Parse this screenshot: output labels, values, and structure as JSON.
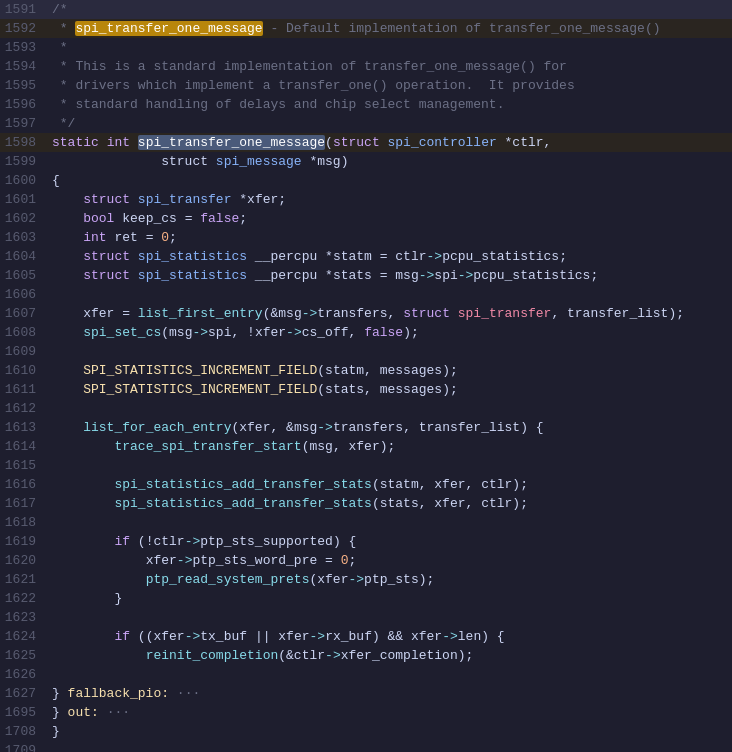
{
  "editor": {
    "lines": [
      {
        "num": "1591",
        "tokens": [
          {
            "t": "/*",
            "c": "c-comment"
          }
        ]
      },
      {
        "num": "1592",
        "tokens": [
          {
            "t": " * ",
            "c": "c-comment"
          },
          {
            "t": "spi_transfer_one_message",
            "c": "c-highlight-yellow"
          },
          {
            "t": " - Default implementation of transfer_one_message()",
            "c": "c-comment"
          }
        ],
        "highlight": true
      },
      {
        "num": "1593",
        "tokens": [
          {
            "t": " *",
            "c": "c-comment"
          }
        ]
      },
      {
        "num": "1594",
        "tokens": [
          {
            "t": " * This is a standard implementation of transfer_one_message() for",
            "c": "c-comment"
          }
        ]
      },
      {
        "num": "1595",
        "tokens": [
          {
            "t": " * drivers which implement a transfer_one() operation.  It provides",
            "c": "c-comment"
          }
        ]
      },
      {
        "num": "1596",
        "tokens": [
          {
            "t": " * standard handling of delays and chip select management.",
            "c": "c-comment"
          }
        ]
      },
      {
        "num": "1597",
        "tokens": [
          {
            "t": " */",
            "c": "c-comment"
          }
        ]
      },
      {
        "num": "1598",
        "tokens": [
          {
            "t": "static",
            "c": "c-keyword"
          },
          {
            "t": " ",
            "c": "c-white"
          },
          {
            "t": "int",
            "c": "c-keyword"
          },
          {
            "t": " ",
            "c": "c-white"
          },
          {
            "t": "spi_transfer_one_message",
            "c": "c-highlight-blue"
          },
          {
            "t": "(",
            "c": "c-white"
          },
          {
            "t": "struct",
            "c": "c-keyword"
          },
          {
            "t": " ",
            "c": "c-white"
          },
          {
            "t": "spi_controller",
            "c": "c-type"
          },
          {
            "t": " *",
            "c": "c-white"
          },
          {
            "t": "ctlr",
            "c": "c-var"
          },
          {
            "t": ",",
            "c": "c-white"
          }
        ],
        "highlight": true
      },
      {
        "num": "1599",
        "tokens": [
          {
            "t": "              struct ",
            "c": "c-white"
          },
          {
            "t": "spi_message",
            "c": "c-type"
          },
          {
            "t": " *",
            "c": "c-white"
          },
          {
            "t": "msg",
            "c": "c-var"
          },
          {
            "t": ")",
            "c": "c-white"
          }
        ]
      },
      {
        "num": "1600",
        "tokens": [
          {
            "t": "{",
            "c": "c-white"
          }
        ]
      },
      {
        "num": "1601",
        "tokens": [
          {
            "t": "    ",
            "c": "c-white"
          },
          {
            "t": "struct",
            "c": "c-keyword"
          },
          {
            "t": " ",
            "c": "c-white"
          },
          {
            "t": "spi_transfer",
            "c": "c-type"
          },
          {
            "t": " *",
            "c": "c-white"
          },
          {
            "t": "xfer",
            "c": "c-var"
          },
          {
            "t": ";",
            "c": "c-white"
          }
        ]
      },
      {
        "num": "1602",
        "tokens": [
          {
            "t": "    ",
            "c": "c-white"
          },
          {
            "t": "bool",
            "c": "c-keyword"
          },
          {
            "t": " ",
            "c": "c-white"
          },
          {
            "t": "keep_cs",
            "c": "c-var"
          },
          {
            "t": " = ",
            "c": "c-white"
          },
          {
            "t": "false",
            "c": "c-keyword"
          },
          {
            "t": ";",
            "c": "c-white"
          }
        ]
      },
      {
        "num": "1603",
        "tokens": [
          {
            "t": "    ",
            "c": "c-white"
          },
          {
            "t": "int",
            "c": "c-keyword"
          },
          {
            "t": " ",
            "c": "c-white"
          },
          {
            "t": "ret",
            "c": "c-var"
          },
          {
            "t": " = ",
            "c": "c-white"
          },
          {
            "t": "0",
            "c": "c-number"
          },
          {
            "t": ";",
            "c": "c-white"
          }
        ]
      },
      {
        "num": "1604",
        "tokens": [
          {
            "t": "    ",
            "c": "c-white"
          },
          {
            "t": "struct",
            "c": "c-keyword"
          },
          {
            "t": " ",
            "c": "c-white"
          },
          {
            "t": "spi_statistics",
            "c": "c-type"
          },
          {
            "t": " __percpu *",
            "c": "c-white"
          },
          {
            "t": "statm",
            "c": "c-var"
          },
          {
            "t": " = ",
            "c": "c-white"
          },
          {
            "t": "ctlr",
            "c": "c-var"
          },
          {
            "t": "->",
            "c": "c-arrow"
          },
          {
            "t": "pcpu_statistics",
            "c": "c-var"
          },
          {
            "t": ";",
            "c": "c-white"
          }
        ]
      },
      {
        "num": "1605",
        "tokens": [
          {
            "t": "    ",
            "c": "c-white"
          },
          {
            "t": "struct",
            "c": "c-keyword"
          },
          {
            "t": " ",
            "c": "c-white"
          },
          {
            "t": "spi_statistics",
            "c": "c-type"
          },
          {
            "t": " __percpu *",
            "c": "c-white"
          },
          {
            "t": "stats",
            "c": "c-var"
          },
          {
            "t": " = ",
            "c": "c-white"
          },
          {
            "t": "msg",
            "c": "c-var"
          },
          {
            "t": "->",
            "c": "c-arrow"
          },
          {
            "t": "spi",
            "c": "c-var"
          },
          {
            "t": "->",
            "c": "c-arrow"
          },
          {
            "t": "pcpu_statistics",
            "c": "c-var"
          },
          {
            "t": ";",
            "c": "c-white"
          }
        ]
      },
      {
        "num": "1606",
        "tokens": []
      },
      {
        "num": "1607",
        "tokens": [
          {
            "t": "    ",
            "c": "c-white"
          },
          {
            "t": "xfer",
            "c": "c-var"
          },
          {
            "t": " = ",
            "c": "c-white"
          },
          {
            "t": "list_first_entry",
            "c": "c-cyan"
          },
          {
            "t": "(&",
            "c": "c-white"
          },
          {
            "t": "msg",
            "c": "c-var"
          },
          {
            "t": "->",
            "c": "c-arrow"
          },
          {
            "t": "transfers",
            "c": "c-var"
          },
          {
            "t": ", ",
            "c": "c-white"
          },
          {
            "t": "struct",
            "c": "c-keyword"
          },
          {
            "t": " ",
            "c": "c-white"
          },
          {
            "t": "spi_transfer",
            "c": "c-red"
          },
          {
            "t": ", ",
            "c": "c-white"
          },
          {
            "t": "transfer_list",
            "c": "c-var"
          },
          {
            "t": ");",
            "c": "c-white"
          }
        ]
      },
      {
        "num": "1608",
        "tokens": [
          {
            "t": "    ",
            "c": "c-white"
          },
          {
            "t": "spi_set_cs",
            "c": "c-cyan"
          },
          {
            "t": "(",
            "c": "c-white"
          },
          {
            "t": "msg",
            "c": "c-var"
          },
          {
            "t": "->",
            "c": "c-arrow"
          },
          {
            "t": "spi",
            "c": "c-var"
          },
          {
            "t": ", !",
            "c": "c-white"
          },
          {
            "t": "xfer",
            "c": "c-var"
          },
          {
            "t": "->",
            "c": "c-arrow"
          },
          {
            "t": "cs_off",
            "c": "c-var"
          },
          {
            "t": ", ",
            "c": "c-white"
          },
          {
            "t": "false",
            "c": "c-keyword"
          },
          {
            "t": ");",
            "c": "c-white"
          }
        ]
      },
      {
        "num": "1609",
        "tokens": []
      },
      {
        "num": "1610",
        "tokens": [
          {
            "t": "    ",
            "c": "c-white"
          },
          {
            "t": "SPI_STATISTICS_INCREMENT_FIELD",
            "c": "c-yellow"
          },
          {
            "t": "(",
            "c": "c-white"
          },
          {
            "t": "statm",
            "c": "c-var"
          },
          {
            "t": ", ",
            "c": "c-white"
          },
          {
            "t": "messages",
            "c": "c-var"
          },
          {
            "t": ");",
            "c": "c-white"
          }
        ]
      },
      {
        "num": "1611",
        "tokens": [
          {
            "t": "    ",
            "c": "c-white"
          },
          {
            "t": "SPI_STATISTICS_INCREMENT_FIELD",
            "c": "c-yellow"
          },
          {
            "t": "(",
            "c": "c-white"
          },
          {
            "t": "stats",
            "c": "c-var"
          },
          {
            "t": ", ",
            "c": "c-white"
          },
          {
            "t": "messages",
            "c": "c-var"
          },
          {
            "t": ");",
            "c": "c-white"
          }
        ]
      },
      {
        "num": "1612",
        "tokens": []
      },
      {
        "num": "1613",
        "tokens": [
          {
            "t": "    ",
            "c": "c-white"
          },
          {
            "t": "list_for_each_entry",
            "c": "c-cyan"
          },
          {
            "t": "(",
            "c": "c-white"
          },
          {
            "t": "xfer",
            "c": "c-var"
          },
          {
            "t": ", &",
            "c": "c-white"
          },
          {
            "t": "msg",
            "c": "c-var"
          },
          {
            "t": "->",
            "c": "c-arrow"
          },
          {
            "t": "transfers",
            "c": "c-var"
          },
          {
            "t": ", ",
            "c": "c-white"
          },
          {
            "t": "transfer_list",
            "c": "c-var"
          },
          {
            "t": ") {",
            "c": "c-white"
          }
        ]
      },
      {
        "num": "1614",
        "tokens": [
          {
            "t": "        ",
            "c": "c-white"
          },
          {
            "t": "trace_spi_transfer_start",
            "c": "c-cyan"
          },
          {
            "t": "(",
            "c": "c-white"
          },
          {
            "t": "msg",
            "c": "c-var"
          },
          {
            "t": ", ",
            "c": "c-white"
          },
          {
            "t": "xfer",
            "c": "c-var"
          },
          {
            "t": ");",
            "c": "c-white"
          }
        ]
      },
      {
        "num": "1615",
        "tokens": []
      },
      {
        "num": "1616",
        "tokens": [
          {
            "t": "        ",
            "c": "c-white"
          },
          {
            "t": "spi_statistics_add_transfer_stats",
            "c": "c-cyan"
          },
          {
            "t": "(",
            "c": "c-white"
          },
          {
            "t": "statm",
            "c": "c-var"
          },
          {
            "t": ", ",
            "c": "c-white"
          },
          {
            "t": "xfer",
            "c": "c-var"
          },
          {
            "t": ", ",
            "c": "c-white"
          },
          {
            "t": "ctlr",
            "c": "c-var"
          },
          {
            "t": ");",
            "c": "c-white"
          }
        ]
      },
      {
        "num": "1617",
        "tokens": [
          {
            "t": "        ",
            "c": "c-white"
          },
          {
            "t": "spi_statistics_add_transfer_stats",
            "c": "c-cyan"
          },
          {
            "t": "(",
            "c": "c-white"
          },
          {
            "t": "stats",
            "c": "c-var"
          },
          {
            "t": ", ",
            "c": "c-white"
          },
          {
            "t": "xfer",
            "c": "c-var"
          },
          {
            "t": ", ",
            "c": "c-white"
          },
          {
            "t": "ctlr",
            "c": "c-var"
          },
          {
            "t": ");",
            "c": "c-white"
          }
        ]
      },
      {
        "num": "1618",
        "tokens": []
      },
      {
        "num": "1619",
        "tokens": [
          {
            "t": "        ",
            "c": "c-white"
          },
          {
            "t": "if",
            "c": "c-keyword"
          },
          {
            "t": " (!",
            "c": "c-white"
          },
          {
            "t": "ctlr",
            "c": "c-var"
          },
          {
            "t": "->",
            "c": "c-arrow"
          },
          {
            "t": "ptp_sts_supported",
            "c": "c-var"
          },
          {
            "t": ") {",
            "c": "c-white"
          }
        ]
      },
      {
        "num": "1620",
        "tokens": [
          {
            "t": "            ",
            "c": "c-white"
          },
          {
            "t": "xfer",
            "c": "c-var"
          },
          {
            "t": "->",
            "c": "c-arrow"
          },
          {
            "t": "ptp_sts_word_pre",
            "c": "c-var"
          },
          {
            "t": " = ",
            "c": "c-white"
          },
          {
            "t": "0",
            "c": "c-number"
          },
          {
            "t": ";",
            "c": "c-white"
          }
        ]
      },
      {
        "num": "1621",
        "tokens": [
          {
            "t": "            ",
            "c": "c-white"
          },
          {
            "t": "ptp_read_system_prets",
            "c": "c-cyan"
          },
          {
            "t": "(",
            "c": "c-white"
          },
          {
            "t": "xfer",
            "c": "c-var"
          },
          {
            "t": "->",
            "c": "c-arrow"
          },
          {
            "t": "ptp_sts",
            "c": "c-var"
          },
          {
            "t": ");",
            "c": "c-white"
          }
        ]
      },
      {
        "num": "1622",
        "tokens": [
          {
            "t": "        }",
            "c": "c-white"
          }
        ]
      },
      {
        "num": "1623",
        "tokens": []
      },
      {
        "num": "1624",
        "tokens": [
          {
            "t": "        ",
            "c": "c-white"
          },
          {
            "t": "if",
            "c": "c-keyword"
          },
          {
            "t": " ((",
            "c": "c-white"
          },
          {
            "t": "xfer",
            "c": "c-var"
          },
          {
            "t": "->",
            "c": "c-arrow"
          },
          {
            "t": "tx_buf",
            "c": "c-var"
          },
          {
            "t": " || ",
            "c": "c-white"
          },
          {
            "t": "xfer",
            "c": "c-var"
          },
          {
            "t": "->",
            "c": "c-arrow"
          },
          {
            "t": "rx_buf",
            "c": "c-var"
          },
          {
            "t": ") && ",
            "c": "c-white"
          },
          {
            "t": "xfer",
            "c": "c-var"
          },
          {
            "t": "->",
            "c": "c-arrow"
          },
          {
            "t": "len",
            "c": "c-var"
          },
          {
            "t": ") {",
            "c": "c-white"
          }
        ]
      },
      {
        "num": "1625",
        "tokens": [
          {
            "t": "            ",
            "c": "c-white"
          },
          {
            "t": "reinit_completion",
            "c": "c-cyan"
          },
          {
            "t": "(&",
            "c": "c-white"
          },
          {
            "t": "ctlr",
            "c": "c-var"
          },
          {
            "t": "->",
            "c": "c-arrow"
          },
          {
            "t": "xfer_completion",
            "c": "c-var"
          },
          {
            "t": ");",
            "c": "c-white"
          }
        ]
      },
      {
        "num": "1626",
        "tokens": []
      },
      {
        "num": "1627",
        "tokens": [
          {
            "t": "} ",
            "c": "c-white"
          },
          {
            "t": "fallback_pio:",
            "c": "c-yellow"
          },
          {
            "t": " ···",
            "c": "c-comment"
          }
        ],
        "collapsed": true
      },
      {
        "num": "1695",
        "tokens": [
          {
            "t": "} ",
            "c": "c-white"
          },
          {
            "t": "out:",
            "c": "c-yellow"
          },
          {
            "t": " ···",
            "c": "c-comment"
          }
        ],
        "collapsed": true
      },
      {
        "num": "1708",
        "tokens": [
          {
            "t": "}",
            "c": "c-white"
          }
        ]
      },
      {
        "num": "1709",
        "tokens": []
      }
    ]
  }
}
